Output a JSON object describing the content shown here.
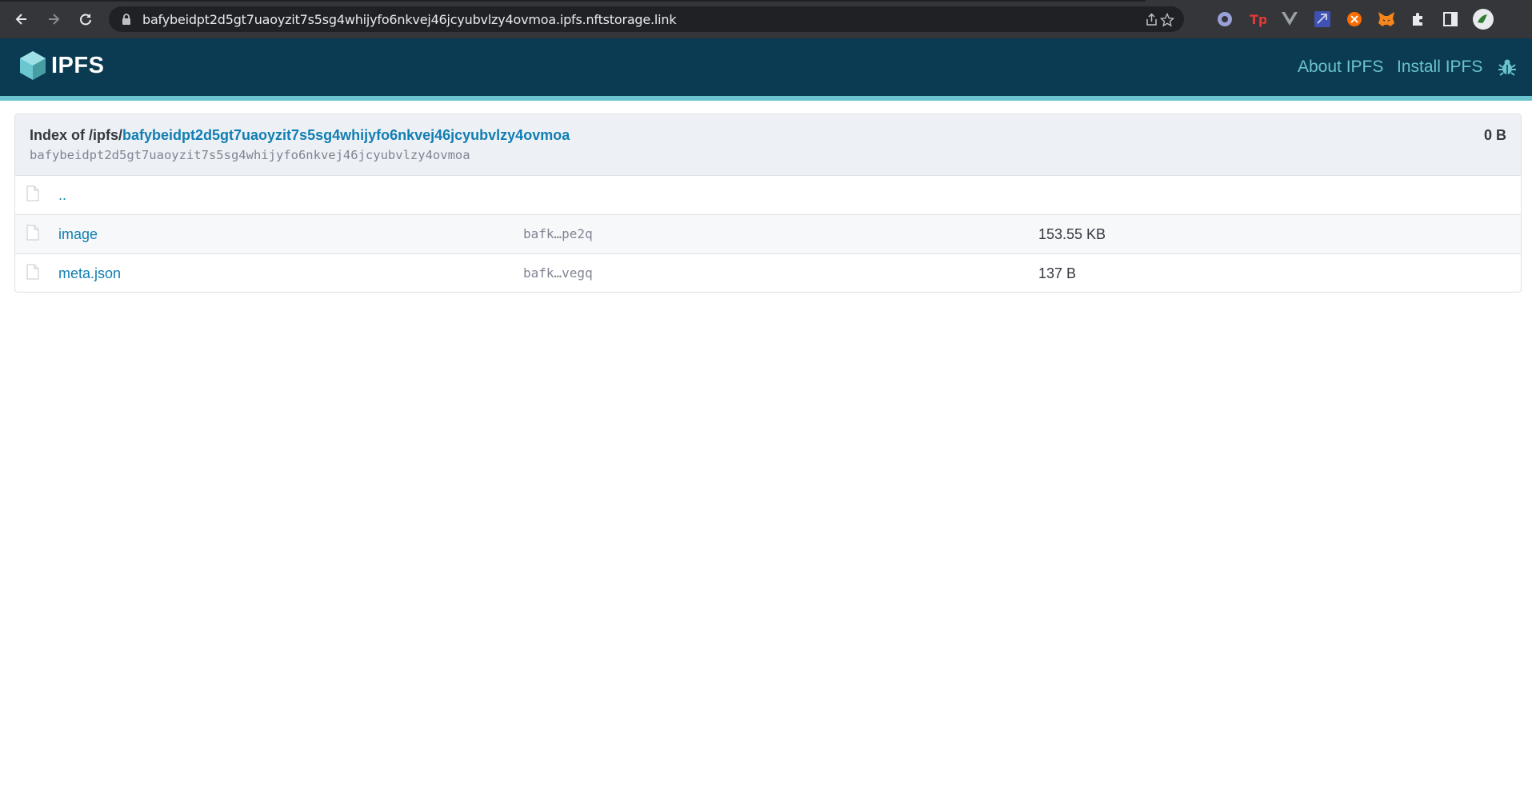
{
  "browser": {
    "url": "bafybeidpt2d5gt7uaoyzit7s5sg4whijyfo6nkvej46jcyubvlzy4ovmoa.ipfs.nftstorage.link",
    "icons": [
      "back-icon",
      "forward-icon",
      "reload-icon",
      "lock-icon",
      "share-icon",
      "star-icon"
    ],
    "extensions": [
      "record-extension-icon",
      "tp-extension-icon",
      "vue-devtools-icon",
      "vpn-extension-icon",
      "orange-extension-icon",
      "metamask-fox-icon",
      "puzzle-extensions-icon",
      "sidepanel-icon",
      "profile-avatar"
    ],
    "colors": {
      "chrome": "#35363a",
      "omnibox": "#202124"
    }
  },
  "header": {
    "logo_text": "IPFS",
    "links": [
      "About IPFS",
      "Install IPFS"
    ],
    "bug_icon": "bug-icon",
    "colors": {
      "background": "#0b3a53",
      "accent": "#69c4cd"
    }
  },
  "index": {
    "prefix": "Index of /ipfs/",
    "cid": "bafybeidpt2d5gt7uaoyzit7s5sg4whijyfo6nkvej46jcyubvlzy4ovmoa",
    "cid_sub": "bafybeidpt2d5gt7uaoyzit7s5sg4whijyfo6nkvej46jcyubvlzy4ovmoa",
    "total_size": "0 B"
  },
  "rows": [
    {
      "name": "..",
      "hash": "",
      "size": ""
    },
    {
      "name": "image",
      "hash": "bafk…pe2q",
      "size": "153.55 KB"
    },
    {
      "name": "meta.json",
      "hash": "bafk…vegq",
      "size": "137 B"
    }
  ]
}
